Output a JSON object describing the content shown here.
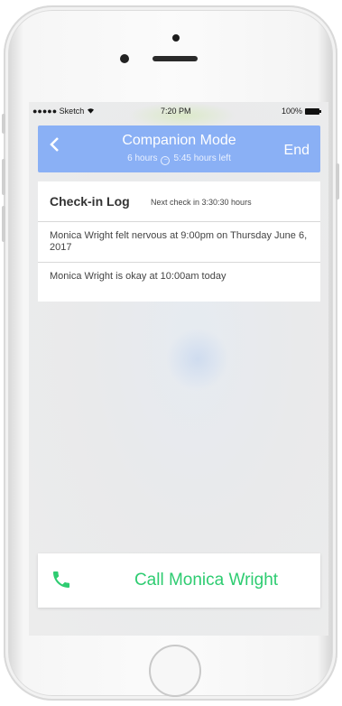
{
  "status_bar": {
    "carrier": "●●●●● Sketch",
    "time": "7:20 PM",
    "battery": "100%"
  },
  "header": {
    "back_icon": "chevron-left-icon",
    "title": "Companion Mode",
    "duration": "6 hours",
    "remaining": "5:45 hours left",
    "end_label": "End",
    "color": "#8ab0f5"
  },
  "checkin_log": {
    "title": "Check-in Log",
    "next_checkin": "Next check in 3:30:30 hours",
    "entries": [
      "Monica Wright felt nervous at 9:00pm on Thursday June 6, 2017",
      "Monica Wright is okay at 10:00am today"
    ]
  },
  "call": {
    "icon": "phone-icon",
    "label": "Call Monica Wright",
    "color": "#2ecc71"
  }
}
